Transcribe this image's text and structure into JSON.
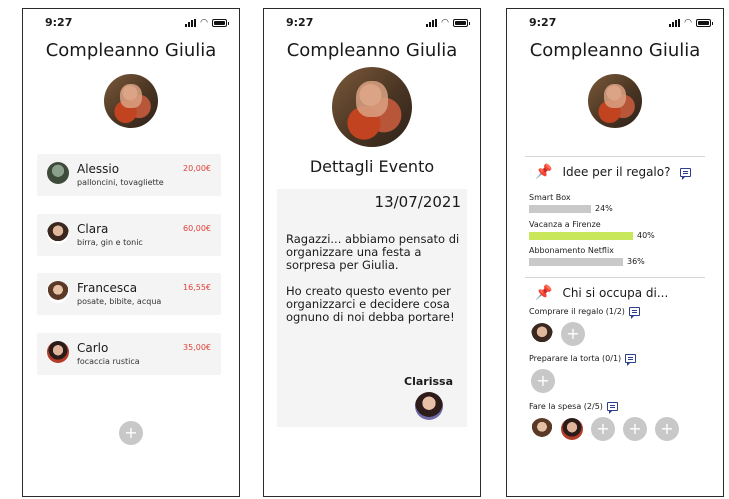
{
  "status": {
    "time": "9:27"
  },
  "event_title": "Compleanno Giulia",
  "screen1": {
    "contributors": [
      {
        "name": "Alessio",
        "items": "palloncini, tovagliette",
        "amount": "20,00€"
      },
      {
        "name": "Clara",
        "items": "birra, gin e tonic",
        "amount": "60,00€"
      },
      {
        "name": "Francesca",
        "items": "posate, bibite, acqua",
        "amount": "16,55€"
      },
      {
        "name": "Carlo",
        "items": "focaccia rustica",
        "amount": "35,00€"
      }
    ],
    "add_label": "+"
  },
  "screen2": {
    "subtitle": "Dettagli Evento",
    "date": "13/07/2021",
    "message": [
      "Ragazzi... abbiamo pensato di organizzare una festa a sorpresa per Giulia.",
      "Ho creato questo evento per organizzarci e decidere cosa ognuno di noi debba portare!"
    ],
    "author": "Clarissa"
  },
  "screen3": {
    "gift_header": "Idee per il regalo?",
    "gift_ideas": [
      {
        "label": "Smart Box",
        "percent": 24,
        "pct_label": "24%"
      },
      {
        "label": "Vacanza a Firenze",
        "percent": 40,
        "pct_label": "40%"
      },
      {
        "label": "Abbonamento Netflix",
        "percent": 36,
        "pct_label": "36%"
      }
    ],
    "tasks_header": "Chi si occupa di...",
    "tasks": [
      {
        "label": "Comprare il regalo (1/2)"
      },
      {
        "label": "Preparare la torta (0/1)"
      },
      {
        "label": "Fare la spesa (2/5)"
      }
    ],
    "add_label": "+"
  }
}
